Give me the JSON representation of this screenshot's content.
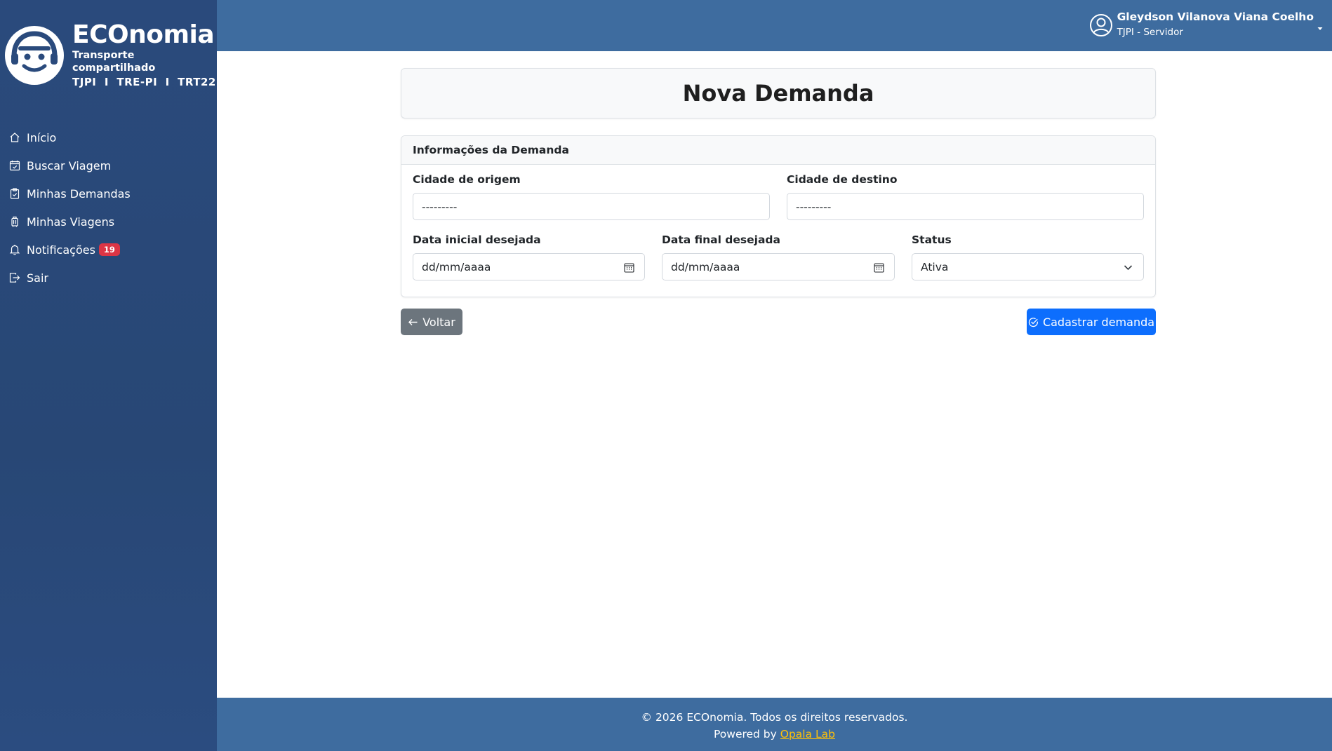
{
  "brand": {
    "name": "ECOnomia",
    "subtitle": "Transporte compartilhado",
    "orgs": "TJPI  I  TRE-PI  I  TRT22"
  },
  "sidebar": {
    "items": [
      {
        "label": "Início",
        "icon": "home-icon"
      },
      {
        "label": "Buscar Viagem",
        "icon": "calendar-check-icon"
      },
      {
        "label": "Minhas Demandas",
        "icon": "clipboard-check-icon"
      },
      {
        "label": "Minhas Viagens",
        "icon": "suitcase-icon"
      },
      {
        "label": "Notificações",
        "icon": "bell-icon",
        "badge": "19"
      },
      {
        "label": "Sair",
        "icon": "logout-icon"
      }
    ]
  },
  "header": {
    "user_name": "Gleydson Vilanova Viana Coelho",
    "user_role": "TJPI - Servidor"
  },
  "page": {
    "title": "Nova Demanda"
  },
  "form": {
    "section_title": "Informações da Demanda",
    "origin": {
      "label": "Cidade de origem",
      "value": "---------"
    },
    "destination": {
      "label": "Cidade de destino",
      "value": "---------"
    },
    "start_date": {
      "label": "Data inicial desejada",
      "value": "dd/mm/aaaa"
    },
    "end_date": {
      "label": "Data final desejada",
      "value": "dd/mm/aaaa"
    },
    "status": {
      "label": "Status",
      "value": "Ativa"
    }
  },
  "actions": {
    "back_label": "Voltar",
    "submit_label": "Cadastrar demanda"
  },
  "footer": {
    "copyright": "© 2026 ECOnomia. Todos os direitos reservados.",
    "powered_prefix": "Powered by ",
    "powered_link": "Opala Lab"
  },
  "colors": {
    "sidebar": "#284775",
    "header": "#3e6c9f",
    "primary": "#0d6efd",
    "secondary": "#6c757d",
    "badge": "#dc3545",
    "link": "#ffc107"
  }
}
